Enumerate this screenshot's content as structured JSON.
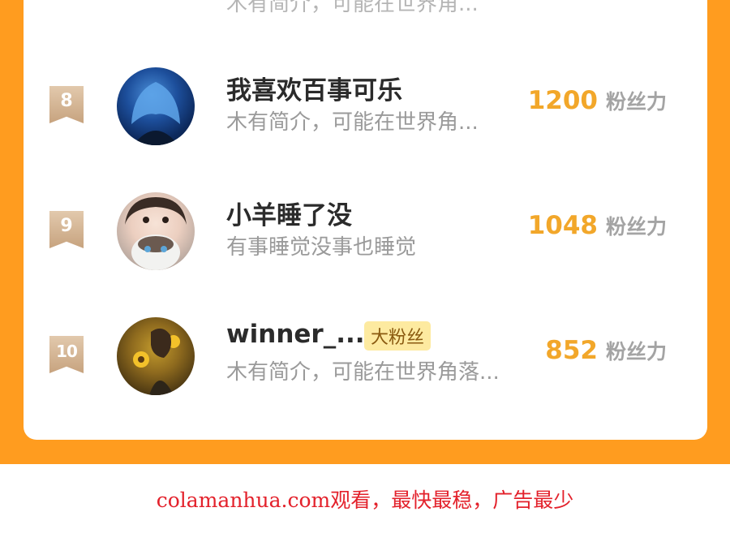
{
  "partial_row": {
    "bio": "木有简介，可能在世界角..."
  },
  "rows": [
    {
      "rank": "8",
      "nickname": "我喜欢百事可乐",
      "bio": "木有简介，可能在世界角...",
      "score": "1200",
      "unit": "粉丝力",
      "avatar": "avatar-blue-hair"
    },
    {
      "rank": "9",
      "nickname": "小羊睡了没",
      "bio": "有事睡觉没事也睡觉",
      "score": "1048",
      "unit": "粉丝力",
      "avatar": "avatar-girl-with-cat"
    },
    {
      "rank": "10",
      "nickname": "winner_...",
      "tag": "大粉丝",
      "bio": "木有简介，可能在世界角落...",
      "score": "852",
      "unit": "粉丝力",
      "avatar": "avatar-boy-sunflowers"
    }
  ],
  "watermark": "colamanhua.com观看，最快最稳，广告最少",
  "colors": {
    "frame": "#ff9c1f",
    "score": "#f2a72a",
    "badge": "#c7a37f",
    "watermark": "#e3212b"
  }
}
